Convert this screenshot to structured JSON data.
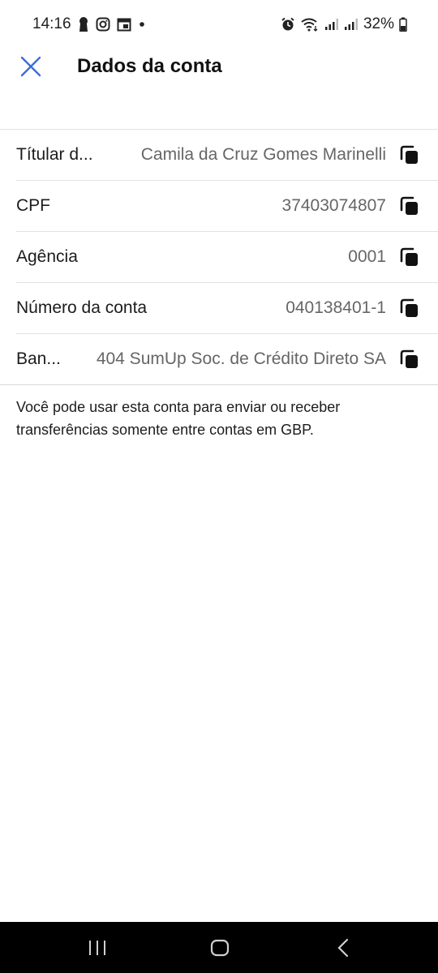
{
  "status_bar": {
    "time": "14:16",
    "battery": "32%",
    "left_icons": [
      "keyhole-icon",
      "instagram-icon",
      "calendar-icon",
      "dot-icon"
    ],
    "right_icons": [
      "alarm-icon",
      "wifi-icon",
      "signal-icon",
      "signal-icon",
      "battery-icon"
    ]
  },
  "header": {
    "title": "Dados da conta",
    "close_icon": "close-icon",
    "accent_color": "#3a6fd8"
  },
  "rows": [
    {
      "label": "Títular d...",
      "value": "Camila da Cruz Gomes Marinelli"
    },
    {
      "label": "CPF",
      "value": "37403074807"
    },
    {
      "label": "Agência",
      "value": "0001"
    },
    {
      "label": "Número da conta",
      "value": "040138401-1"
    },
    {
      "label": "Ban...",
      "value": "404 SumUp Soc. de Crédito Direto SA"
    }
  ],
  "info_text": "Você pode usar esta conta para enviar ou receber transferências somente entre contas em GBP.",
  "nav_bar": {
    "buttons": [
      "recents-icon",
      "home-icon",
      "back-icon"
    ]
  }
}
